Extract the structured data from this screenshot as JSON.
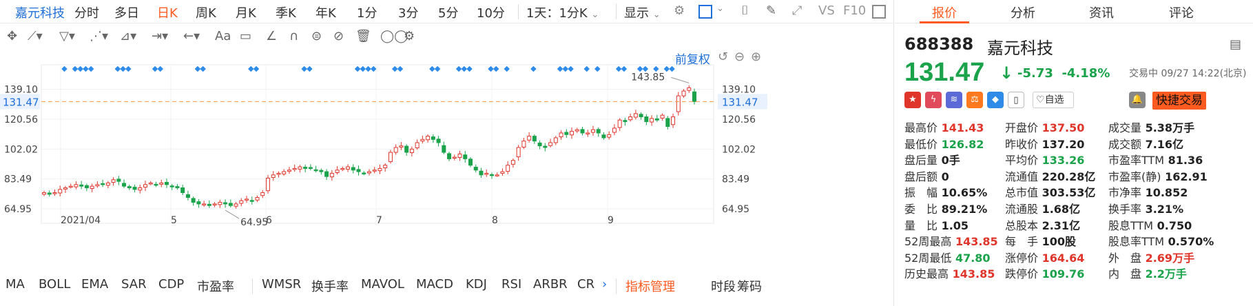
{
  "period_bar": {
    "stock_name": "嘉元科技",
    "items": [
      "分时",
      "多日",
      "日K",
      "周K",
      "月K",
      "季K",
      "年K",
      "1分",
      "3分",
      "5分",
      "10分"
    ],
    "active": "日K",
    "interval": "1天：1分K",
    "display": "显示",
    "vs": "VS",
    "f10": "F10"
  },
  "toolbar": {
    "text_tool": "Aa"
  },
  "chart": {
    "adjust_label": "前复权",
    "current_price_label": "131.47",
    "high_marker": "143.85",
    "low_marker": "64.95"
  },
  "chart_data": {
    "type": "candlestick",
    "y_ticks": [
      "139.10",
      "120.56",
      "102.02",
      "83.49",
      "64.95"
    ],
    "ylim": [
      50,
      150
    ],
    "x_labels": [
      "2021/04",
      "5",
      "6",
      "7",
      "8",
      "9"
    ],
    "current_price": 131.47,
    "period_high": 143.85,
    "period_low": 64.95,
    "closes": [
      75,
      74,
      75,
      77,
      78,
      79,
      80,
      79,
      78,
      79,
      80,
      80,
      81,
      83,
      82,
      79,
      78,
      77,
      78,
      80,
      81,
      80,
      81,
      80,
      79,
      78,
      75,
      72,
      69,
      68,
      68,
      67,
      68,
      69,
      68,
      67,
      68,
      70,
      71,
      70,
      72,
      75,
      84,
      86,
      87,
      88,
      89,
      90,
      91,
      90,
      90,
      89,
      88,
      85,
      87,
      89,
      90,
      91,
      89,
      88,
      87,
      88,
      89,
      90,
      92,
      100,
      103,
      104,
      100,
      102,
      106,
      108,
      110,
      108,
      106,
      100,
      96,
      97,
      99,
      96,
      92,
      89,
      86,
      87,
      86,
      86,
      88,
      92,
      95,
      103,
      107,
      110,
      107,
      104,
      103,
      106,
      109,
      112,
      111,
      113,
      114,
      112,
      112,
      114,
      112,
      109,
      111,
      115,
      120,
      119,
      122,
      124,
      122,
      119,
      121,
      120,
      123,
      116,
      122,
      135,
      138,
      140,
      131.47
    ],
    "markers_y": "top-row",
    "markers": [
      2,
      4,
      5,
      6,
      7,
      12,
      13,
      14,
      19,
      20,
      27,
      28,
      37,
      38,
      47,
      48,
      57,
      58,
      59,
      60,
      64,
      65,
      71,
      72,
      76,
      77,
      78,
      82,
      83,
      85,
      90,
      95,
      96,
      97,
      100,
      102,
      106,
      107,
      110,
      111,
      113,
      115,
      116
    ]
  },
  "indicators": [
    "MA",
    "BOLL",
    "EMA",
    "SAR",
    "CDP",
    "市盈率",
    "WMSR",
    "换手率",
    "MAVOL",
    "MACD",
    "KDJ",
    "RSI",
    "ARBR",
    "CR"
  ],
  "indicator_manager": "指标管理",
  "indicator_right": [
    "时段",
    "筹码"
  ],
  "right_tabs": [
    "报价",
    "分析",
    "资讯",
    "评论"
  ],
  "quote": {
    "code": "688388",
    "name": "嘉元科技",
    "price": "131.47",
    "change": "-5.73",
    "change_pct": "-4.18%",
    "trade_status": "交易中 09/27 14:22(北京)",
    "watchlist": "自选",
    "quick_trade": "快捷交易",
    "col1": [
      {
        "label": "最高价",
        "value": "141.43",
        "cls": "red"
      },
      {
        "label": "最低价",
        "value": "126.82",
        "cls": "grn"
      },
      {
        "label": "盘后量",
        "value": "0手",
        "cls": "blk"
      },
      {
        "label": "盘后额",
        "value": "0",
        "cls": "blk"
      },
      {
        "label": "振　幅",
        "value": "10.65%",
        "cls": "blk"
      },
      {
        "label": "委　比",
        "value": "89.21%",
        "cls": "blk"
      },
      {
        "label": "量　比",
        "value": "1.05",
        "cls": "blk"
      },
      {
        "label": "52周最高",
        "value": "143.85",
        "cls": "red"
      },
      {
        "label": "52周最低",
        "value": "47.80",
        "cls": "grn"
      },
      {
        "label": "历史最高",
        "value": "143.85",
        "cls": "red"
      }
    ],
    "col2": [
      {
        "label": "开盘价",
        "value": "137.50",
        "cls": "red"
      },
      {
        "label": "昨收价",
        "value": "137.20",
        "cls": "blk"
      },
      {
        "label": "平均价",
        "value": "133.26",
        "cls": "grn"
      },
      {
        "label": "流通值",
        "value": "220.28亿",
        "cls": "blk"
      },
      {
        "label": "总市值",
        "value": "303.53亿",
        "cls": "blk"
      },
      {
        "label": "流通股",
        "value": "1.68亿",
        "cls": "blk"
      },
      {
        "label": "总股本",
        "value": "2.31亿",
        "cls": "blk"
      },
      {
        "label": "每　手",
        "value": "100股",
        "cls": "blk"
      },
      {
        "label": "涨停价",
        "value": "164.64",
        "cls": "red"
      },
      {
        "label": "跌停价",
        "value": "109.76",
        "cls": "grn"
      }
    ],
    "col3": [
      {
        "label": "成交量",
        "value": "5.38万手",
        "cls": "blk"
      },
      {
        "label": "成交额",
        "value": "7.16亿",
        "cls": "blk"
      },
      {
        "label": "市盈率TTM",
        "value": "81.36",
        "cls": "blk"
      },
      {
        "label": "市盈率(静)",
        "value": "162.91",
        "cls": "blk"
      },
      {
        "label": "市净率",
        "value": "10.852",
        "cls": "blk"
      },
      {
        "label": "换手率",
        "value": "3.21%",
        "cls": "blk"
      },
      {
        "label": "股息TTM",
        "value": "0.750",
        "cls": "blk"
      },
      {
        "label": "股息率TTM",
        "value": "0.570%",
        "cls": "blk"
      },
      {
        "label": "外　盘",
        "value": "2.69万手",
        "cls": "red"
      },
      {
        "label": "内　盘",
        "value": "2.2万手",
        "cls": "grn"
      }
    ]
  }
}
